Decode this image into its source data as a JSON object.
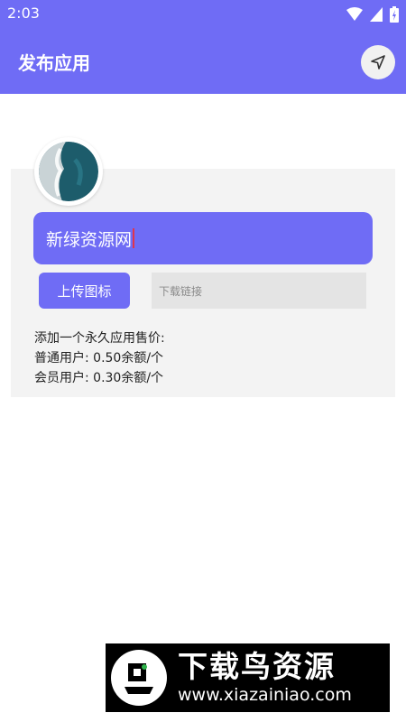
{
  "status_bar": {
    "time": "2:03",
    "wifi_icon": "wifi-icon",
    "signal_icon": "signal-icon",
    "battery_icon": "battery-icon"
  },
  "app_bar": {
    "title": "发布应用",
    "send_icon": "send-icon"
  },
  "form": {
    "app_name_value": "新绿资源网",
    "upload_icon_label": "上传图标",
    "download_link_placeholder": "下载链接"
  },
  "pricing": {
    "line1": "添加一个永久应用售价:",
    "line2": "普通用户: 0.50余额/个",
    "line3": "会员用户: 0.30余额/个"
  },
  "watermark": {
    "title": "下载鸟资源",
    "url": "www.xiazainiao.com"
  },
  "colors": {
    "primary": "#6f6cf5",
    "card": "#f3f3f3",
    "input_bg": "#e4e4e4"
  }
}
